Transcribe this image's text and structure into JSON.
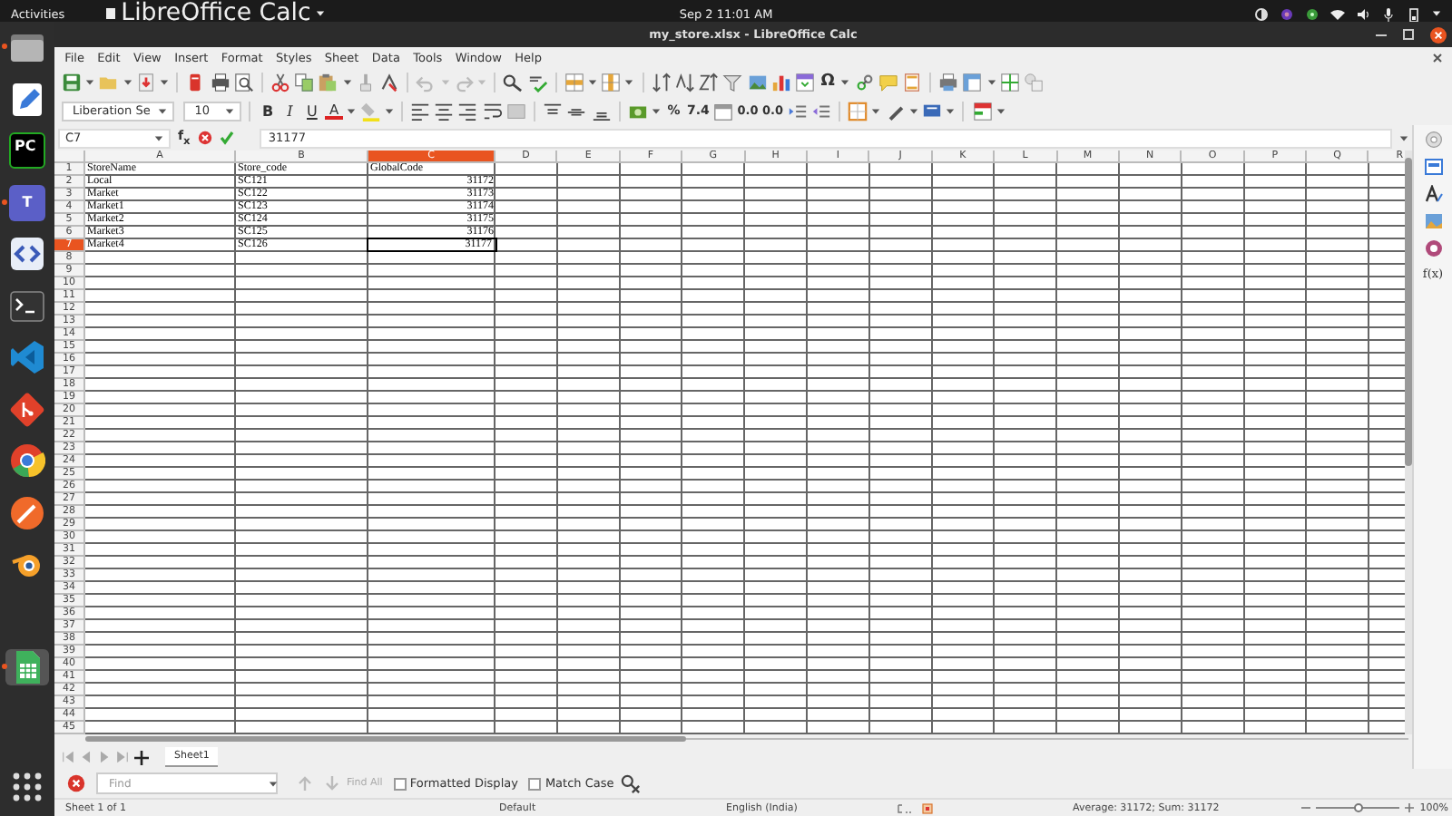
{
  "top_bar": {
    "activities": "Activities",
    "app_menu": "LibreOffice Calc",
    "clock": "Sep 2  11:01 AM"
  },
  "dock": [
    {
      "kind": "files",
      "running": true,
      "selected": false
    },
    {
      "kind": "editor",
      "running": false,
      "selected": false
    },
    {
      "kind": "pycharm",
      "label": "PC",
      "running": false,
      "selected": false
    },
    {
      "kind": "teams",
      "label": "T",
      "running": true,
      "selected": false
    },
    {
      "kind": "brackets",
      "running": false,
      "selected": false
    },
    {
      "kind": "terminal",
      "running": false,
      "selected": false
    },
    {
      "kind": "vscode",
      "running": false,
      "selected": false
    },
    {
      "kind": "git",
      "running": false,
      "selected": false
    },
    {
      "kind": "chrome",
      "running": false,
      "selected": false
    },
    {
      "kind": "postman",
      "running": false,
      "selected": false
    },
    {
      "kind": "blender",
      "running": false,
      "selected": false
    },
    {
      "kind": "calc",
      "running": true,
      "selected": true
    },
    {
      "kind": "apps",
      "running": false,
      "selected": false
    }
  ],
  "window": {
    "title": "my_store.xlsx - LibreOffice Calc"
  },
  "menu": [
    "File",
    "Edit",
    "View",
    "Insert",
    "Format",
    "Styles",
    "Sheet",
    "Data",
    "Tools",
    "Window",
    "Help"
  ],
  "standard_toolbar": {
    "undo": {
      "disabled": true
    },
    "redo": {
      "disabled": true
    },
    "special_character": "Ω"
  },
  "formatting_toolbar": {
    "font_name": "Liberation Se",
    "font_size": "10",
    "buttons": [
      "B",
      "I",
      "U",
      "A",
      "%",
      "7.4",
      "0.0",
      "0.0"
    ]
  },
  "formula_bar": {
    "cell": "C7",
    "function_wizard": "f$_{x}$",
    "value": "31177"
  },
  "sheet": {
    "columns": [
      {
        "label": "A",
        "selected": false
      },
      {
        "label": "B",
        "selected": false
      },
      {
        "label": "C",
        "selected": true
      },
      {
        "label": "D",
        "selected": false
      },
      {
        "label": "E",
        "selected": false
      },
      {
        "label": "F",
        "selected": false
      },
      {
        "label": "G",
        "selected": false
      },
      {
        "label": "H",
        "selected": false
      },
      {
        "label": "I",
        "selected": false
      },
      {
        "label": "J",
        "selected": false
      },
      {
        "label": "K",
        "selected": false
      },
      {
        "label": "L",
        "selected": false
      },
      {
        "label": "M",
        "selected": false
      },
      {
        "label": "N",
        "selected": false
      },
      {
        "label": "O",
        "selected": false
      },
      {
        "label": "P",
        "selected": false
      },
      {
        "label": "Q",
        "selected": false
      },
      {
        "label": "R",
        "selected": false
      }
    ],
    "rows": [
      {
        "label": "1",
        "selected": false,
        "cells": [
          {
            "text": "StoreName",
            "kind": "text",
            "selected": false
          },
          {
            "text": "Store_code",
            "kind": "text",
            "selected": false
          },
          {
            "text": "GlobalCode",
            "kind": "text",
            "selected": false
          }
        ]
      },
      {
        "label": "2",
        "selected": false,
        "cells": [
          {
            "text": "Local",
            "kind": "text",
            "selected": false
          },
          {
            "text": "SC121",
            "kind": "text",
            "selected": false
          },
          {
            "text": "31172",
            "kind": "number",
            "selected": false
          }
        ]
      },
      {
        "label": "3",
        "selected": false,
        "cells": [
          {
            "text": "Market",
            "kind": "text",
            "selected": false
          },
          {
            "text": "SC122",
            "kind": "text",
            "selected": false
          },
          {
            "text": "31173",
            "kind": "number",
            "selected": false
          }
        ]
      },
      {
        "label": "4",
        "selected": false,
        "cells": [
          {
            "text": "Market1",
            "kind": "text",
            "selected": false
          },
          {
            "text": "SC123",
            "kind": "text",
            "selected": false
          },
          {
            "text": "31174",
            "kind": "number",
            "selected": false
          }
        ]
      },
      {
        "label": "5",
        "selected": false,
        "cells": [
          {
            "text": "Market2",
            "kind": "text",
            "selected": false
          },
          {
            "text": "SC124",
            "kind": "text",
            "selected": false
          },
          {
            "text": "31175",
            "kind": "number",
            "selected": false
          }
        ]
      },
      {
        "label": "6",
        "selected": false,
        "cells": [
          {
            "text": "Market3",
            "kind": "text",
            "selected": false
          },
          {
            "text": "SC125",
            "kind": "text",
            "selected": false
          },
          {
            "text": "31176",
            "kind": "number",
            "selected": false
          }
        ]
      },
      {
        "label": "7",
        "selected": true,
        "cells": [
          {
            "text": "Market4",
            "kind": "text",
            "selected": false
          },
          {
            "text": "SC126",
            "kind": "text",
            "selected": false
          },
          {
            "text": "31177",
            "kind": "number",
            "selected": true
          }
        ]
      },
      {
        "label": "8",
        "selected": false
      },
      {
        "label": "9",
        "selected": false
      },
      {
        "label": "10",
        "selected": false
      },
      {
        "label": "11",
        "selected": false
      },
      {
        "label": "12",
        "selected": false
      },
      {
        "label": "13",
        "selected": false
      },
      {
        "label": "14",
        "selected": false
      },
      {
        "label": "15",
        "selected": false
      },
      {
        "label": "16",
        "selected": false
      },
      {
        "label": "17",
        "selected": false
      },
      {
        "label": "18",
        "selected": false
      },
      {
        "label": "19",
        "selected": false
      },
      {
        "label": "20",
        "selected": false
      },
      {
        "label": "21",
        "selected": false
      },
      {
        "label": "22",
        "selected": false
      },
      {
        "label": "23",
        "selected": false
      },
      {
        "label": "24",
        "selected": false
      },
      {
        "label": "25",
        "selected": false
      },
      {
        "label": "26",
        "selected": false
      },
      {
        "label": "27",
        "selected": false
      },
      {
        "label": "28",
        "selected": false
      },
      {
        "label": "29",
        "selected": false
      },
      {
        "label": "30",
        "selected": false
      },
      {
        "label": "31",
        "selected": false
      },
      {
        "label": "32",
        "selected": false
      },
      {
        "label": "33",
        "selected": false
      },
      {
        "label": "34",
        "selected": false
      },
      {
        "label": "35",
        "selected": false
      },
      {
        "label": "36",
        "selected": false
      },
      {
        "label": "37",
        "selected": false
      },
      {
        "label": "38",
        "selected": false
      },
      {
        "label": "39",
        "selected": false
      },
      {
        "label": "40",
        "selected": false
      },
      {
        "label": "41",
        "selected": false
      },
      {
        "label": "42",
        "selected": false
      },
      {
        "label": "43",
        "selected": false
      },
      {
        "label": "44",
        "selected": false
      },
      {
        "label": "45",
        "selected": false
      }
    ]
  },
  "sheet_tabs": [
    {
      "label": "Sheet1",
      "selected": true
    }
  ],
  "sidebar": {
    "functions": "f(x)"
  },
  "find_bar": {
    "placeholder": "Find",
    "previous": {
      "disabled": true
    },
    "next": {
      "disabled": true
    },
    "find_all": {
      "label": "Find All",
      "disabled": true
    },
    "options": [
      {
        "label": "Formatted Display",
        "checked": false
      },
      {
        "label": "Match Case",
        "checked": false
      }
    ]
  },
  "status_bar": {
    "sheet": "Sheet 1 of 1",
    "page_style": "Default",
    "language": "English (India)",
    "selection": "Average: 31172; Sum: 31172",
    "zoom_slider": {
      "level": 0.5
    },
    "zoom": "100%"
  }
}
